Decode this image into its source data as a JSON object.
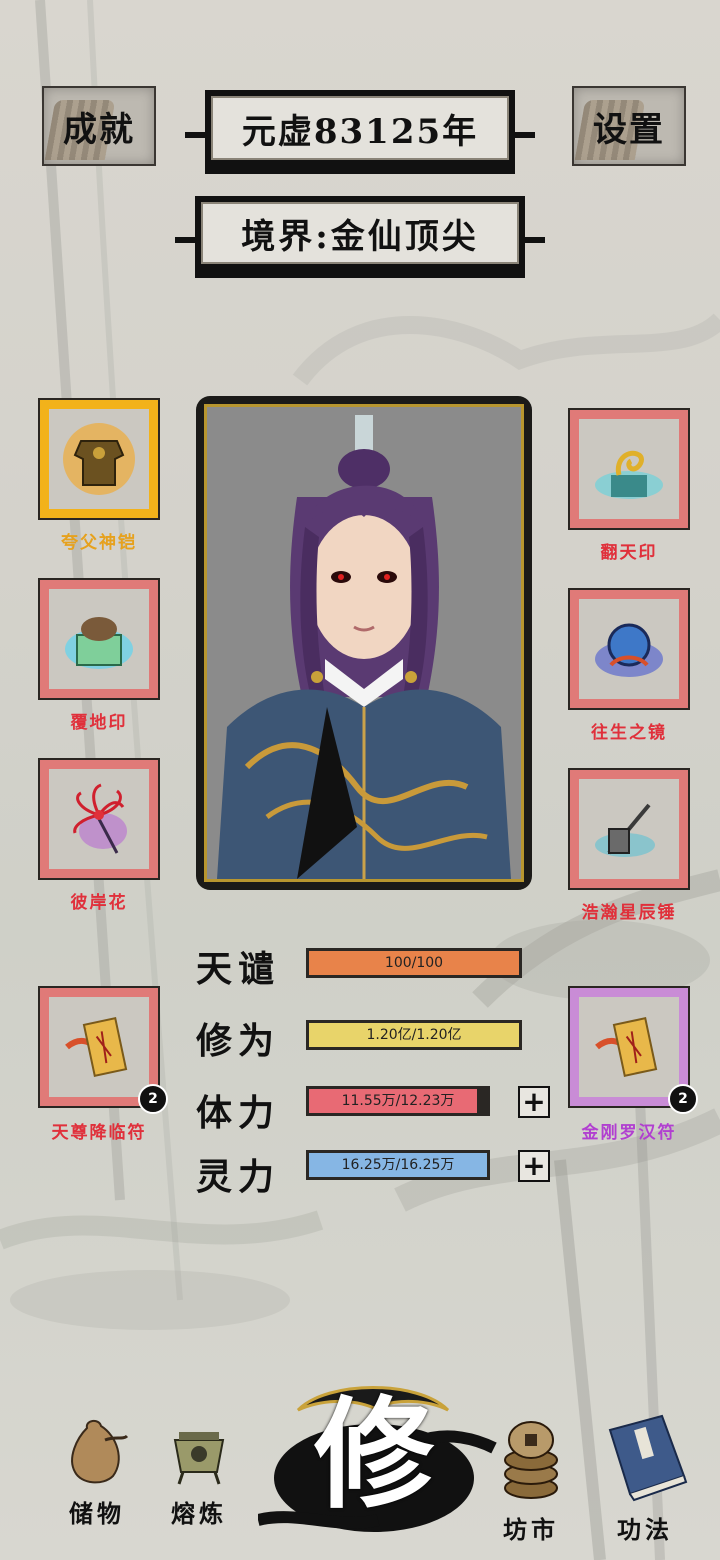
{
  "header": {
    "achievements_label": "成就",
    "settings_label": "设置",
    "year_text": "元虚83125年",
    "realm_text": "境界:金仙顶尖"
  },
  "equipment": {
    "left": [
      {
        "name": "夸父神铠",
        "rarity": "gold",
        "icon": "armor-icon"
      },
      {
        "name": "覆地印",
        "rarity": "red",
        "icon": "turtle-seal-icon"
      },
      {
        "name": "彼岸花",
        "rarity": "red",
        "icon": "red-spider-lily-icon"
      },
      {
        "name": "天尊降临符",
        "rarity": "red",
        "icon": "talisman-icon",
        "count": "2"
      }
    ],
    "right": [
      {
        "name": "翻天印",
        "rarity": "red",
        "icon": "dragon-seal-icon"
      },
      {
        "name": "往生之镜",
        "rarity": "red",
        "icon": "mirror-icon"
      },
      {
        "name": "浩瀚星辰锤",
        "rarity": "red",
        "icon": "hammer-icon"
      },
      {
        "name": "金刚罗汉符",
        "rarity": "purple",
        "icon": "talisman-icon",
        "count": "2"
      }
    ]
  },
  "stats": [
    {
      "label": "天谴",
      "text": "100/100",
      "ratio": 1.0,
      "color": "#e8834a"
    },
    {
      "label": "修为",
      "text": "1.20亿/1.20亿",
      "ratio": 1.0,
      "color": "#e8d46a"
    },
    {
      "label": "体力",
      "text": "11.55万/12.23万",
      "ratio": 0.944,
      "color": "#e86a74"
    },
    {
      "label": "灵力",
      "text": "16.25万/16.25万",
      "ratio": 1.0,
      "color": "#86b6e4"
    }
  ],
  "nav": {
    "storage": "储物",
    "smelting": "熔炼",
    "cultivate": "修",
    "market": "坊市",
    "techniques": "功法"
  }
}
